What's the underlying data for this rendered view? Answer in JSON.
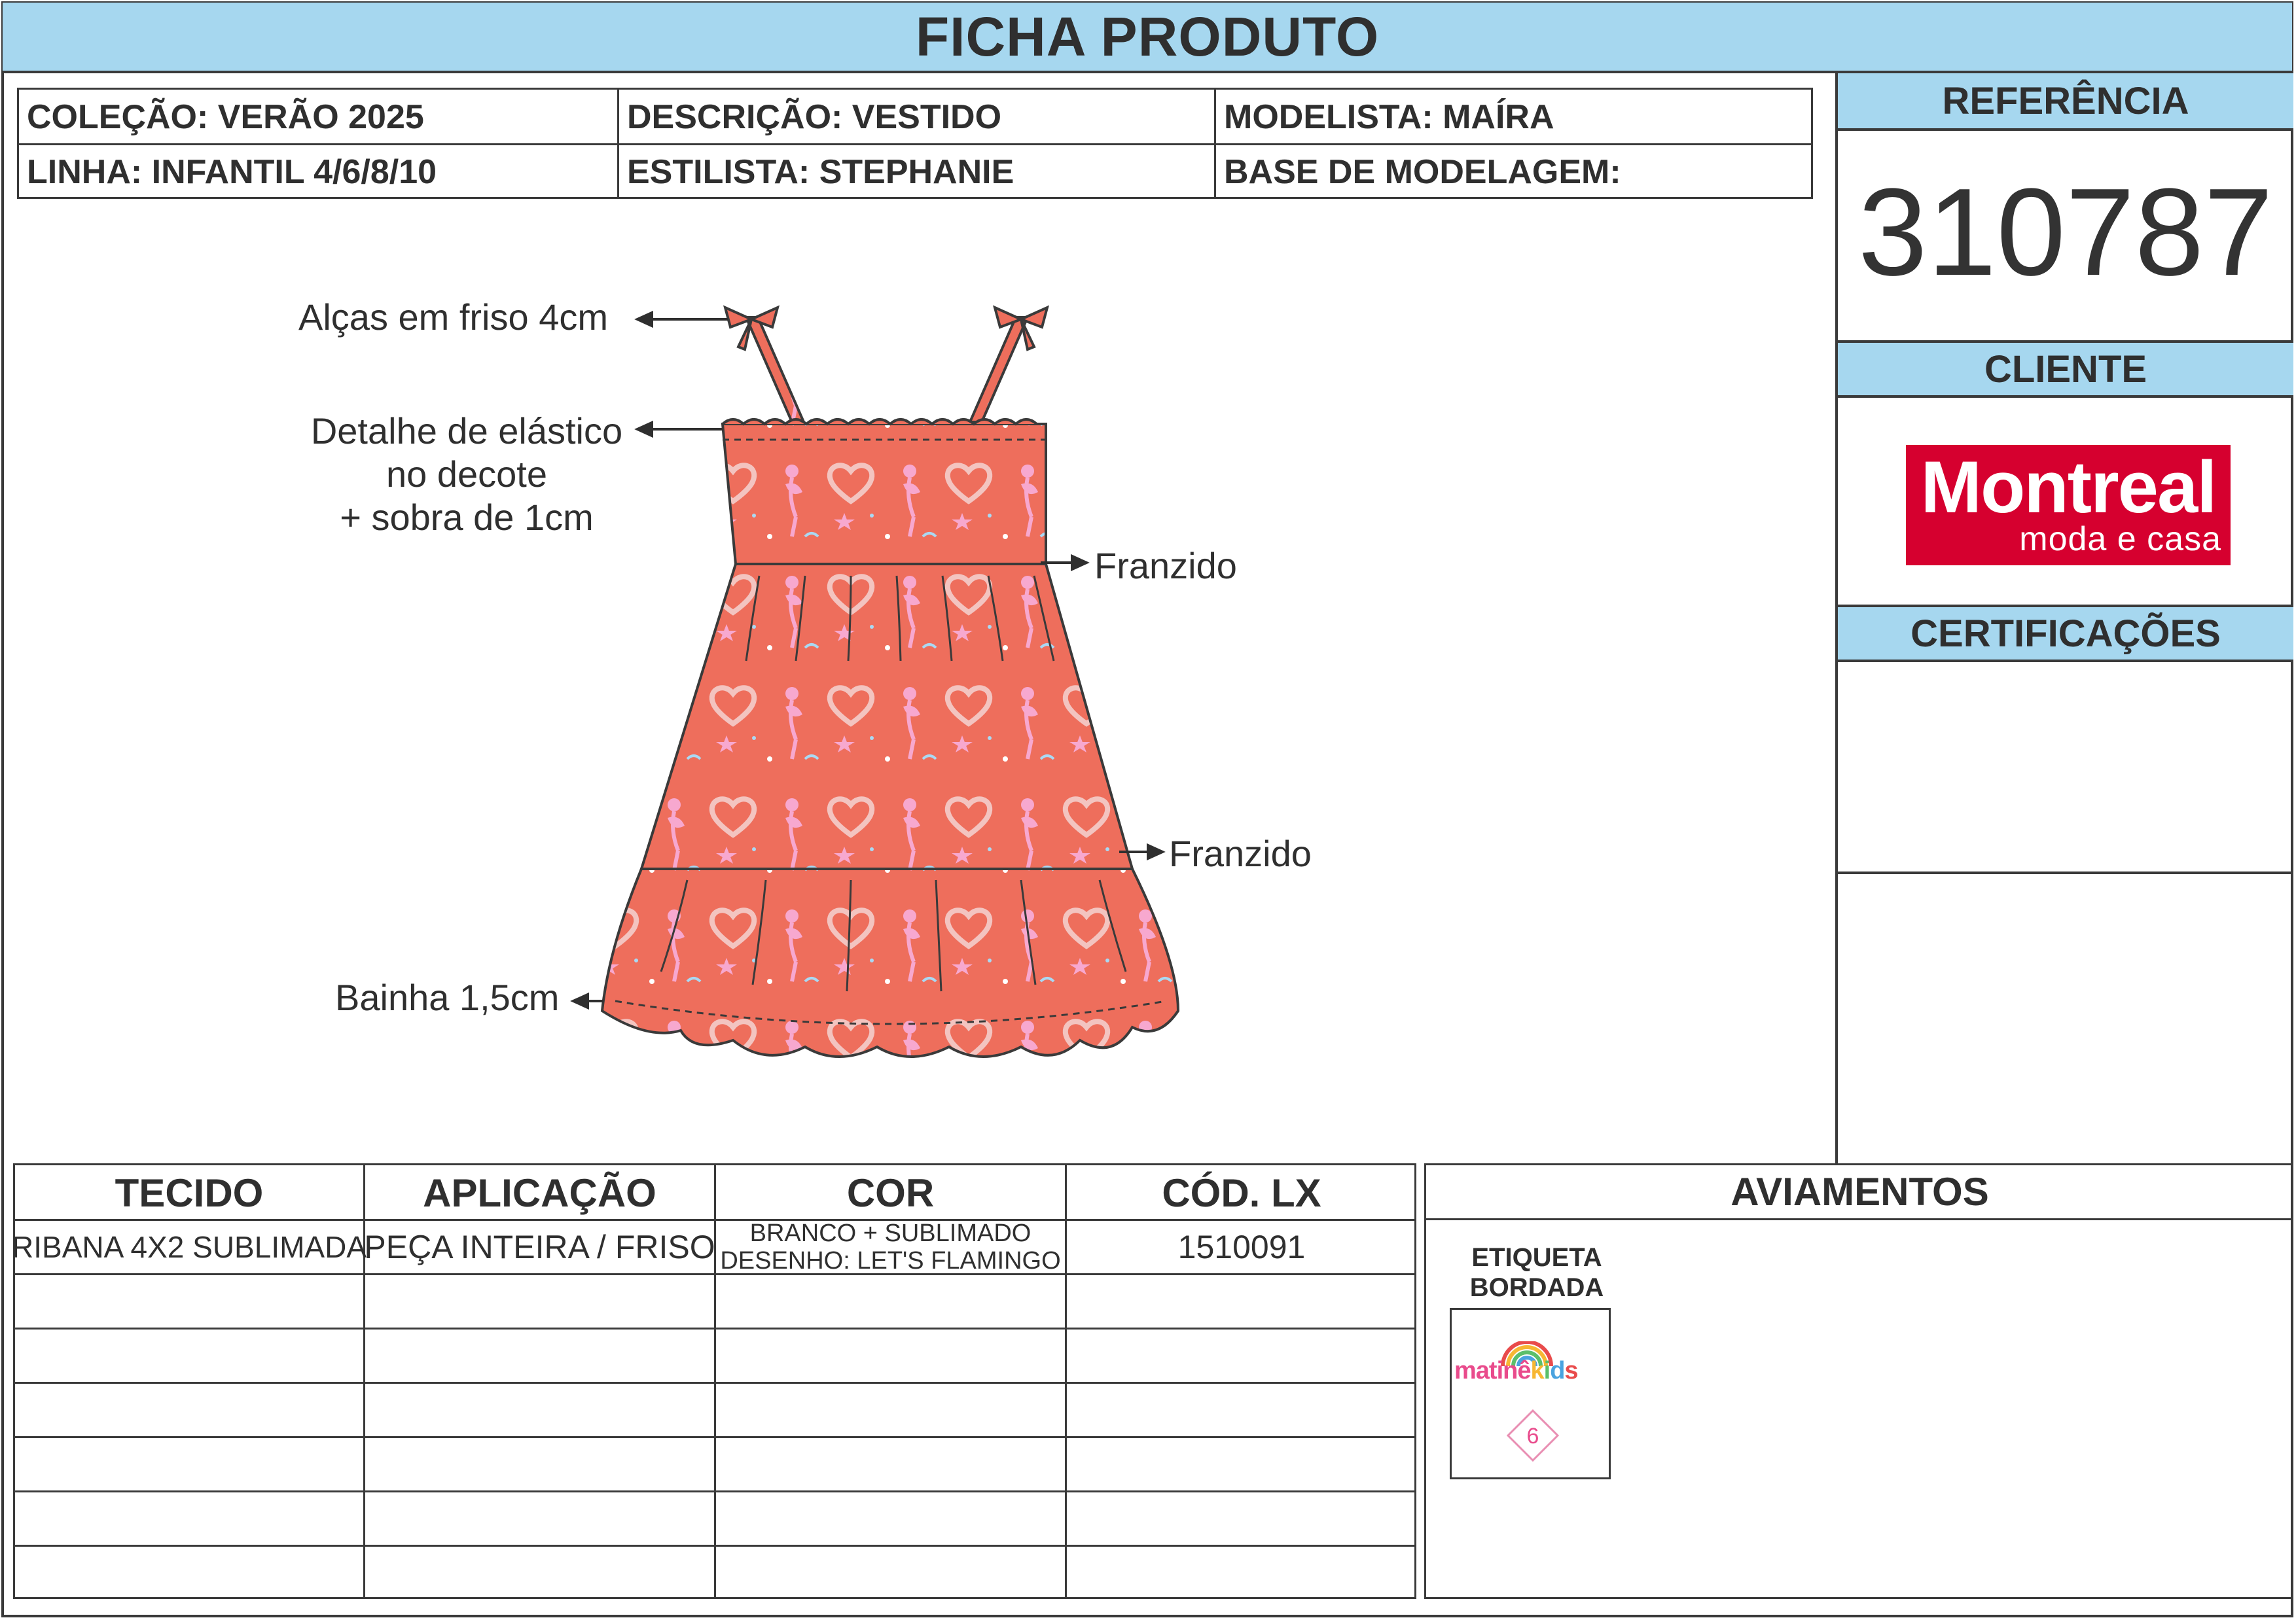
{
  "header": {
    "title": "FICHA PRODUTO"
  },
  "info": {
    "colecao": "COLEÇÃO: VERÃO 2025",
    "descricao": "DESCRIÇÃO: VESTIDO",
    "modelista": "MODELISTA: MAÍRA",
    "linha": "LINHA: INFANTIL 4/6/8/10",
    "estilista": "ESTILISTA: STEPHANIE",
    "base": "BASE DE MODELAGEM:"
  },
  "referencia": {
    "label": "REFERÊNCIA",
    "value": "310787"
  },
  "cliente": {
    "label": "CLIENTE",
    "logo_main": "Montreal",
    "logo_sub": "moda e casa"
  },
  "certificacoes": {
    "label": "CERTIFICAÇÕES"
  },
  "annotations": {
    "alcas": "Alças em friso 4cm",
    "elastico": [
      "Detalhe de elástico",
      "no decote",
      "+ sobra de 1cm"
    ],
    "franzido_1": "Franzido",
    "franzido_2": "Franzido",
    "bainha": "Bainha 1,5cm"
  },
  "materials_table": {
    "headers": [
      "TECIDO",
      "APLICAÇÃO",
      "COR",
      "CÓD. LX"
    ],
    "rows": [
      {
        "tecido": "RIBANA 4X2 SUBLIMADA",
        "aplicacao": "PEÇA INTEIRA / FRISO",
        "cor": [
          "BRANCO + SUBLIMADO",
          "DESENHO: LET'S FLAMINGO"
        ],
        "cod": "1510091"
      }
    ]
  },
  "aviamentos": {
    "label": "AVIAMENTOS",
    "items": [
      {
        "label": [
          "ETIQUETA",
          "BORDADA"
        ],
        "logo": "matinêkids",
        "size": "6"
      }
    ]
  },
  "colors": {
    "header_blue": "#a6d7ef",
    "dress_coral": "#ee6e5c",
    "logo_red": "#d6002f",
    "print_pink": "#f7a8cf"
  }
}
